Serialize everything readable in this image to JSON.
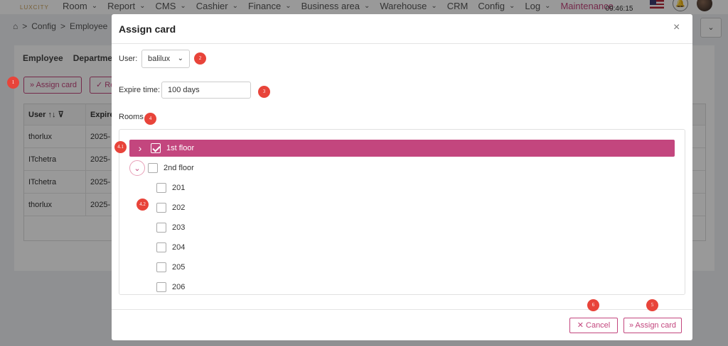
{
  "nav": {
    "logo": "LUXCITY",
    "items": [
      {
        "label": "Room"
      },
      {
        "label": "Report"
      },
      {
        "label": "CMS"
      },
      {
        "label": "Cashier"
      },
      {
        "label": "Finance"
      },
      {
        "label": "Business area"
      },
      {
        "label": "Warehouse"
      },
      {
        "label": "CRM"
      },
      {
        "label": "Config"
      },
      {
        "label": "Log"
      }
    ],
    "active_item": "Maintenance",
    "time": "09:46:15",
    "chevron": "⌄"
  },
  "breadcrumb": {
    "home_icon": "home-icon",
    "items": [
      "Config",
      "Employee"
    ],
    "separator": ">"
  },
  "background": {
    "tabs": [
      "Employee",
      "Department"
    ],
    "assign_btn": "» Assign card",
    "re_btn": "✓ Re",
    "table": {
      "headers": [
        "User ↑↓ ⊽",
        "Expire"
      ],
      "rows": [
        [
          "thorlux",
          "2025-"
        ],
        [
          "ITchetra",
          "2025-"
        ],
        [
          "ITchetra",
          "2025-"
        ],
        [
          "thorlux",
          "2025-"
        ]
      ]
    }
  },
  "markers": [
    "1",
    "2",
    "3",
    "4",
    "4.1",
    "4.2",
    "5",
    "6"
  ],
  "modal": {
    "title": "Assign card",
    "close": "×",
    "user_label": "User:",
    "user_value": "balilux",
    "expire_label": "Expire time:",
    "expire_value": "100 days",
    "rooms_label": "Rooms",
    "tree": {
      "floor1": {
        "label": "1st floor",
        "toggle": "›"
      },
      "floor2": {
        "label": "2nd floor",
        "toggle": "⌄"
      },
      "rooms": [
        "201",
        "202",
        "203",
        "204",
        "205",
        "206"
      ]
    },
    "cancel": "✕  Cancel",
    "assign": "»  Assign card"
  },
  "colors": {
    "accent": "#c3467e",
    "marker": "#e8443a"
  }
}
